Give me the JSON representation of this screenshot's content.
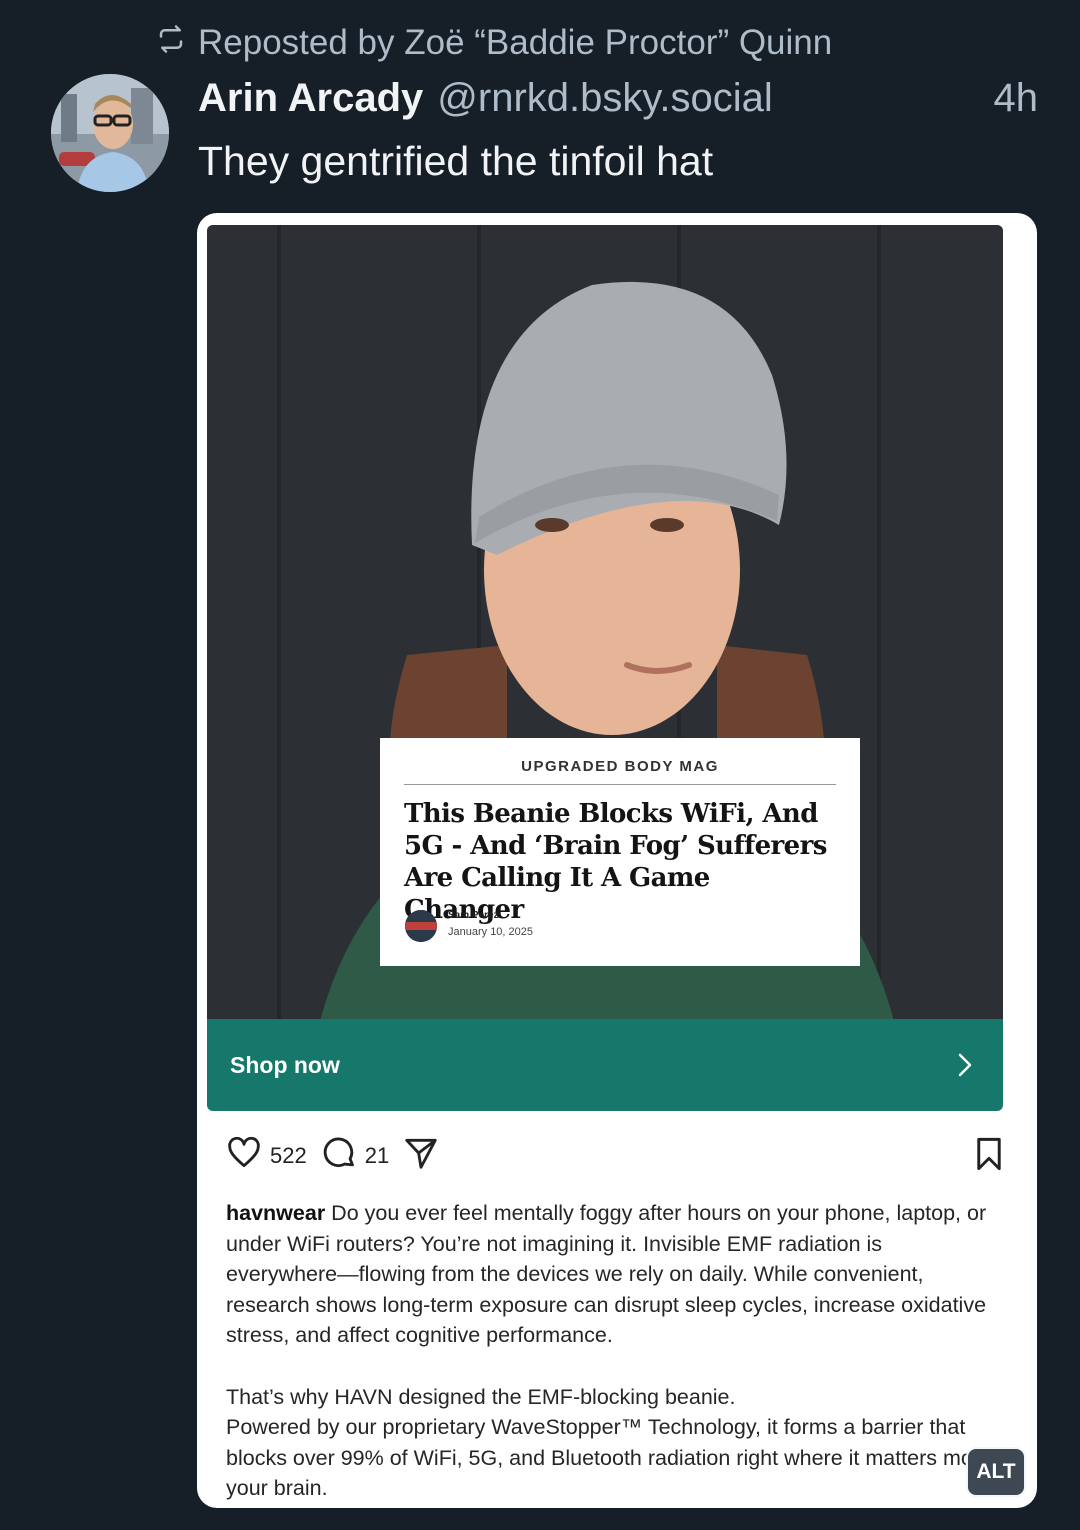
{
  "repost": {
    "label": "Reposted by Zoë “Baddie Proctor” Quinn",
    "icon": "repost-icon"
  },
  "post": {
    "author_name": "Arin Arcady",
    "author_handle": "@rnrkd.bsky.social",
    "timestamp": "4h",
    "text": "They gentrified the tinfoil hat"
  },
  "embed": {
    "article": {
      "source": "UPGRADED BODY MAG",
      "headline": "This Beanie Blocks WiFi, And 5G - And ‘Brain Fog’ Sufferers Are Calling It A Game Changer",
      "author": "Sam Perez",
      "date": "January 10, 2025"
    },
    "shop_label": "Shop now",
    "likes": "522",
    "comments": "21",
    "caption_user": "havnwear",
    "caption_p1": "Do you ever feel mentally foggy after hours on your phone, laptop, or under WiFi routers? You’re not imagining it. Invisible EMF radiation is everywhere—flowing from the devices we rely on daily. While convenient, research shows long-term exposure can disrupt sleep cycles, increase oxidative stress, and affect cognitive performance.",
    "caption_p2": "That’s why HAVN designed the EMF-blocking beanie.",
    "caption_p3": "Powered by our proprietary WaveStopper™ Technology, it forms a barrier that blocks over 99% of WiFi, 5G, and Bluetooth radiation right where it matters most: your brain.",
    "alt_badge": "ALT"
  },
  "colors": {
    "background": "#161e27",
    "shop_bar": "#16786a",
    "muted_text": "#aebbc9"
  }
}
